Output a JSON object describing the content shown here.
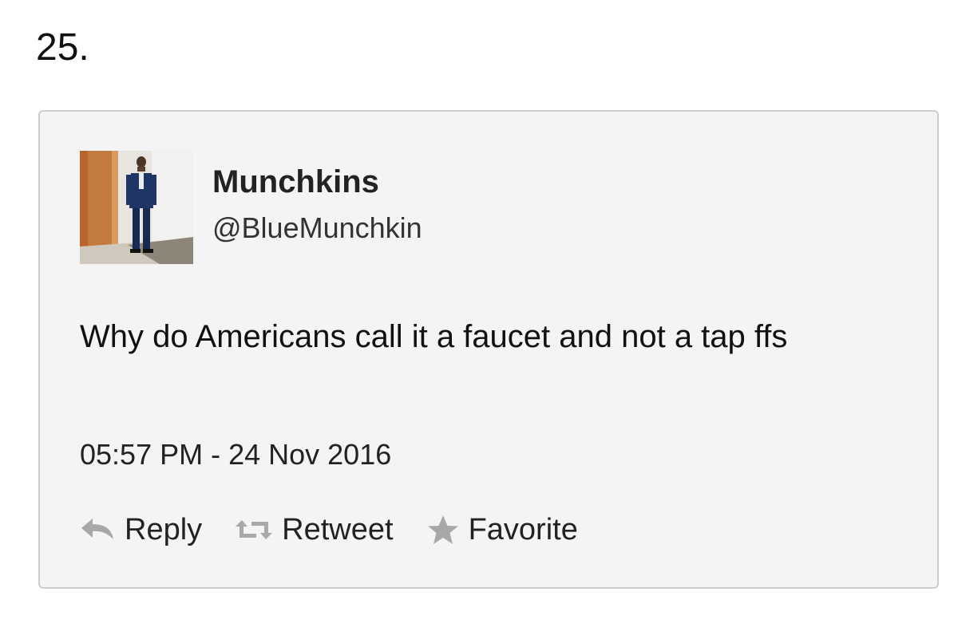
{
  "list_number": "25.",
  "tweet": {
    "display_name": "Munchkins",
    "handle": "@BlueMunchkin",
    "text": "Why do Americans call it a faucet and not a tap ffs",
    "timestamp": "05:57 PM - 24 Nov 2016",
    "actions": {
      "reply_label": "Reply",
      "reply_icon": "reply-arrow-icon",
      "retweet_label": "Retweet",
      "retweet_icon": "retweet-icon",
      "favorite_label": "Favorite",
      "favorite_icon": "star-icon"
    }
  },
  "colors": {
    "card_background": "#f4f4f4",
    "card_border": "#cdcdcd",
    "icon_gray": "#a8a8a8",
    "text": "#111111"
  }
}
